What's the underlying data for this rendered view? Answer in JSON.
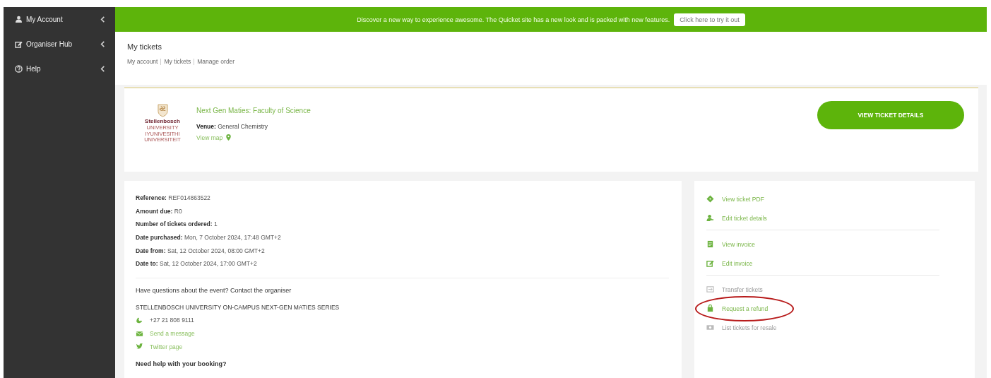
{
  "sidebar": {
    "items": [
      {
        "label": "My Account",
        "kind": "user"
      },
      {
        "label": "Organiser Hub",
        "kind": "edit"
      },
      {
        "label": "Help",
        "kind": "help"
      }
    ]
  },
  "banner": {
    "message": "Discover a new way to experience awesome. The Quicket site has a new look and is packed with new features.",
    "button": "Click here to try it out"
  },
  "header": {
    "title": "My tickets",
    "breadcrumb": [
      "My account",
      "My tickets",
      "Manage order"
    ]
  },
  "event": {
    "logo_name": "Stellenbosch",
    "logo_subtitle": "UNIVERSITY IYUNIVESITHI UNIVERSITEIT",
    "title": "Next Gen Maties: Faculty of Science",
    "venue_label": "Venue:",
    "venue": "General Chemistry",
    "map_link": "View map",
    "button": "VIEW TICKET DETAILS"
  },
  "order": {
    "fields": [
      {
        "label": "Reference:",
        "value": "REF014863522"
      },
      {
        "label": "Amount due:",
        "value": "R0"
      },
      {
        "label": "Number of tickets ordered:",
        "value": "1"
      },
      {
        "label": "Date purchased:",
        "value": "Mon, 7 October 2024, 17:48 GMT+2"
      },
      {
        "label": "Date from:",
        "value": "Sat, 12 October 2024, 08:00 GMT+2"
      },
      {
        "label": "Date to:",
        "value": "Sat, 12 October 2024, 17:00 GMT+2"
      }
    ],
    "contact_prompt": "Have questions about the event? Contact the organiser",
    "organiser": "STELLENBOSCH UNIVERSITY ON-CAMPUS NEXT-GEN MATIES SERIES",
    "contacts": [
      {
        "kind": "phone",
        "text": "+27 21 808 9111"
      },
      {
        "kind": "message",
        "text": "Send a message"
      },
      {
        "kind": "twitter",
        "text": "Twitter page"
      }
    ],
    "help_heading": "Need help with your booking?"
  },
  "actions": {
    "groups": [
      [
        {
          "kind": "ticket",
          "label": "View ticket PDF",
          "disabled": false,
          "highlighted": false
        },
        {
          "kind": "person",
          "label": "Edit ticket details",
          "disabled": false,
          "highlighted": false
        }
      ],
      [
        {
          "kind": "invoice",
          "label": "View invoice",
          "disabled": false,
          "highlighted": false
        },
        {
          "kind": "edit",
          "label": "Edit invoice",
          "disabled": false,
          "highlighted": false
        }
      ],
      [
        {
          "kind": "transfer",
          "label": "Transfer tickets",
          "disabled": true,
          "highlighted": false
        },
        {
          "kind": "refund",
          "label": "Request a refund",
          "disabled": false,
          "highlighted": true
        },
        {
          "kind": "resale",
          "label": "List tickets for resale",
          "disabled": true,
          "highlighted": false
        }
      ]
    ]
  }
}
